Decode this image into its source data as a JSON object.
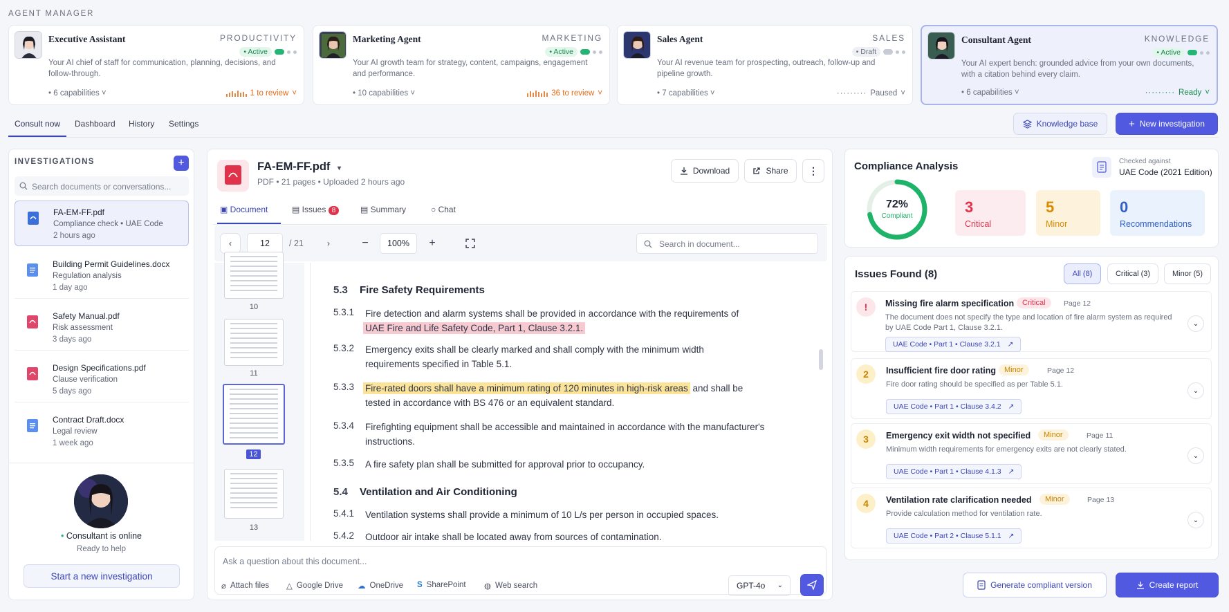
{
  "header": {
    "title": "AGENT MANAGER"
  },
  "agents": [
    {
      "name": "Executive Assistant",
      "category": "PRODUCTIVITY",
      "status": "Active",
      "description": "Your AI chief of staff for communication, planning, decisions, and follow-through.",
      "capabilities": "6 capabilities",
      "review": "1 to review"
    },
    {
      "name": "Marketing Agent",
      "category": "MARKETING",
      "status": "Active",
      "description": "Your AI growth team for strategy, content, campaigns, engagement and performance.",
      "capabilities": "10 capabilities",
      "review": "36 to review"
    },
    {
      "name": "Sales Agent",
      "category": "SALES",
      "status": "Draft",
      "description": "Your AI revenue team for prospecting, outreach, follow-up and pipeline growth.",
      "capabilities": "7 capabilities",
      "review": "Paused"
    },
    {
      "name": "Consultant Agent",
      "category": "KNOWLEDGE",
      "status": "Active",
      "description": "Your AI expert bench: grounded advice from your own documents, with a citation behind every claim.",
      "capabilities": "6 capabilities",
      "review": "Ready"
    }
  ],
  "nav": {
    "tabs": [
      "Consult now",
      "Dashboard",
      "History",
      "Settings"
    ],
    "knowledge_base": "Knowledge base",
    "new_investigation": "New investigation"
  },
  "sidebar": {
    "title": "INVESTIGATIONS",
    "search_placeholder": "Search documents or conversations...",
    "items": [
      {
        "title": "FA-EM-FF.pdf",
        "subtitle": "Compliance check • UAE Code",
        "time": "2 hours ago",
        "type": "pdf"
      },
      {
        "title": "Building Permit Guidelines.docx",
        "subtitle": "Regulation analysis",
        "time": "1 day ago",
        "type": "docx"
      },
      {
        "title": "Safety Manual.pdf",
        "subtitle": "Risk assessment",
        "time": "3 days ago",
        "type": "pdf"
      },
      {
        "title": "Design Specifications.pdf",
        "subtitle": "Clause verification",
        "time": "5 days ago",
        "type": "pdf"
      },
      {
        "title": "Contract Draft.docx",
        "subtitle": "Legal review",
        "time": "1 week ago",
        "type": "docx"
      }
    ],
    "consultant_status": "Consultant is online",
    "consultant_sub": "Ready to help",
    "start_button": "Start a new investigation"
  },
  "document": {
    "filename": "FA-EM-FF.pdf",
    "meta": "PDF • 21 pages • Uploaded 2 hours ago",
    "download": "Download",
    "share": "Share",
    "tabs": {
      "document": "Document",
      "issues": "Issues",
      "issues_count": "8",
      "summary": "Summary",
      "chat": "Chat"
    },
    "page": "12",
    "total": "/ 21",
    "zoom": "100%",
    "search_placeholder": "Search in document...",
    "thumbs": [
      "10",
      "11",
      "12",
      "13"
    ],
    "sections": {
      "s53_num": "5.3",
      "s53_title": "Fire Safety Requirements",
      "c531_num": "5.3.1",
      "c531_a": "Fire detection and alarm systems shall be provided in accordance with the requirements of",
      "c531_b": "UAE Fire and Life Safety Code, Part 1, Clause 3.2.1.",
      "c532_num": "5.3.2",
      "c532": "Emergency exits shall be clearly marked and shall comply with the minimum width requirements specified in Table 5.1.",
      "c533_num": "5.3.3",
      "c533_hl": "Fire-rated doors shall have a minimum rating of 120 minutes in high-risk areas",
      "c533_a": "and shall be",
      "c533_b": "tested in accordance with BS 476 or an equivalent standard.",
      "c534_num": "5.3.4",
      "c534": "Firefighting equipment shall be accessible and maintained in accordance with the manufacturer's instructions.",
      "c535_num": "5.3.5",
      "c535": "A fire safety plan shall be submitted for approval prior to occupancy.",
      "s54_num": "5.4",
      "s54_title": "Ventilation and Air Conditioning",
      "c541_num": "5.4.1",
      "c541": "Ventilation systems shall provide a minimum of 10 L/s per person in occupied spaces.",
      "c542_num": "5.4.2",
      "c542": "Outdoor air intake shall be located away from sources of contamination."
    }
  },
  "chat": {
    "placeholder": "Ask a question about this document...",
    "tools": [
      "Attach files",
      "Google Drive",
      "OneDrive",
      "SharePoint",
      "Web search"
    ],
    "model": "GPT-4o"
  },
  "compliance": {
    "title": "Compliance Analysis",
    "checked_label": "Checked against",
    "checked_value": "UAE Code (2021 Edition)",
    "percent_label": "72%",
    "percent_value": 0.72,
    "compliant_label": "Compliant",
    "critical_count": "3",
    "critical_label": "Critical",
    "minor_count": "5",
    "minor_label": "Minor",
    "rec_count": "0",
    "rec_label": "Recommendations",
    "colors": {
      "critical": "#e0324a",
      "minor": "#d98a00",
      "rec": "#2f5fc7",
      "gauge": "#1fb36a"
    }
  },
  "issues": {
    "title": "Issues Found (8)",
    "filters": [
      "All (8)",
      "Critical (3)",
      "Minor (5)"
    ],
    "items": [
      {
        "num": "!",
        "title": "Missing fire alarm specification",
        "badge": "Critical",
        "page": "Page 12",
        "desc": "The document does not specify the type and location of fire alarm system as required by UAE Code Part 1, Clause 3.2.1.",
        "ref": "UAE Code • Part 1 • Clause 3.2.1"
      },
      {
        "num": "2",
        "title": "Insufficient fire door rating",
        "badge": "Minor",
        "page": "Page 12",
        "desc": "Fire door rating should be specified as per Table 5.1.",
        "ref": "UAE Code • Part 1 • Clause 3.4.2"
      },
      {
        "num": "3",
        "title": "Emergency exit width not specified",
        "badge": "Minor",
        "page": "Page 11",
        "desc": "Minimum width requirements for emergency exits are not clearly stated.",
        "ref": "UAE Code • Part 1 • Clause 4.1.3"
      },
      {
        "num": "4",
        "title": "Ventilation rate clarification needed",
        "badge": "Minor",
        "page": "Page 13",
        "desc": "Provide calculation method for ventilation rate.",
        "ref": "UAE Code • Part 2 • Clause 5.1.1"
      }
    ]
  },
  "footer": {
    "generate": "Generate compliant version",
    "create": "Create report"
  }
}
